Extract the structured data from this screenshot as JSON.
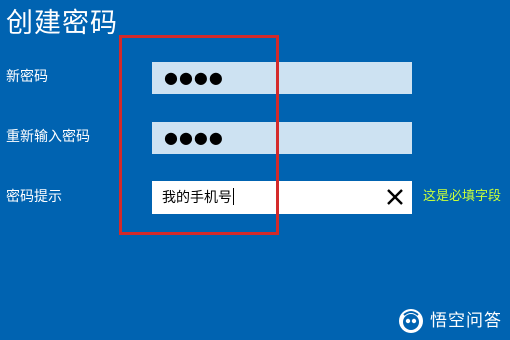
{
  "page": {
    "title": "创建密码"
  },
  "new_password": {
    "label": "新密码",
    "masked_value": "●●●●"
  },
  "confirm_password": {
    "label": "重新输入密码",
    "masked_value": "●●●●"
  },
  "password_hint": {
    "label": "密码提示",
    "value": "我的手机号",
    "clear_icon": "close-icon"
  },
  "note": {
    "text": "这是必填字段"
  },
  "annotation": {
    "color": "#d42a2a"
  },
  "watermark": {
    "text": "悟空问答",
    "icon": "wukong-logo-icon"
  },
  "colors": {
    "background": "#0063b1",
    "input_fill": "#cde2f2",
    "note": "#c8ff3a"
  }
}
